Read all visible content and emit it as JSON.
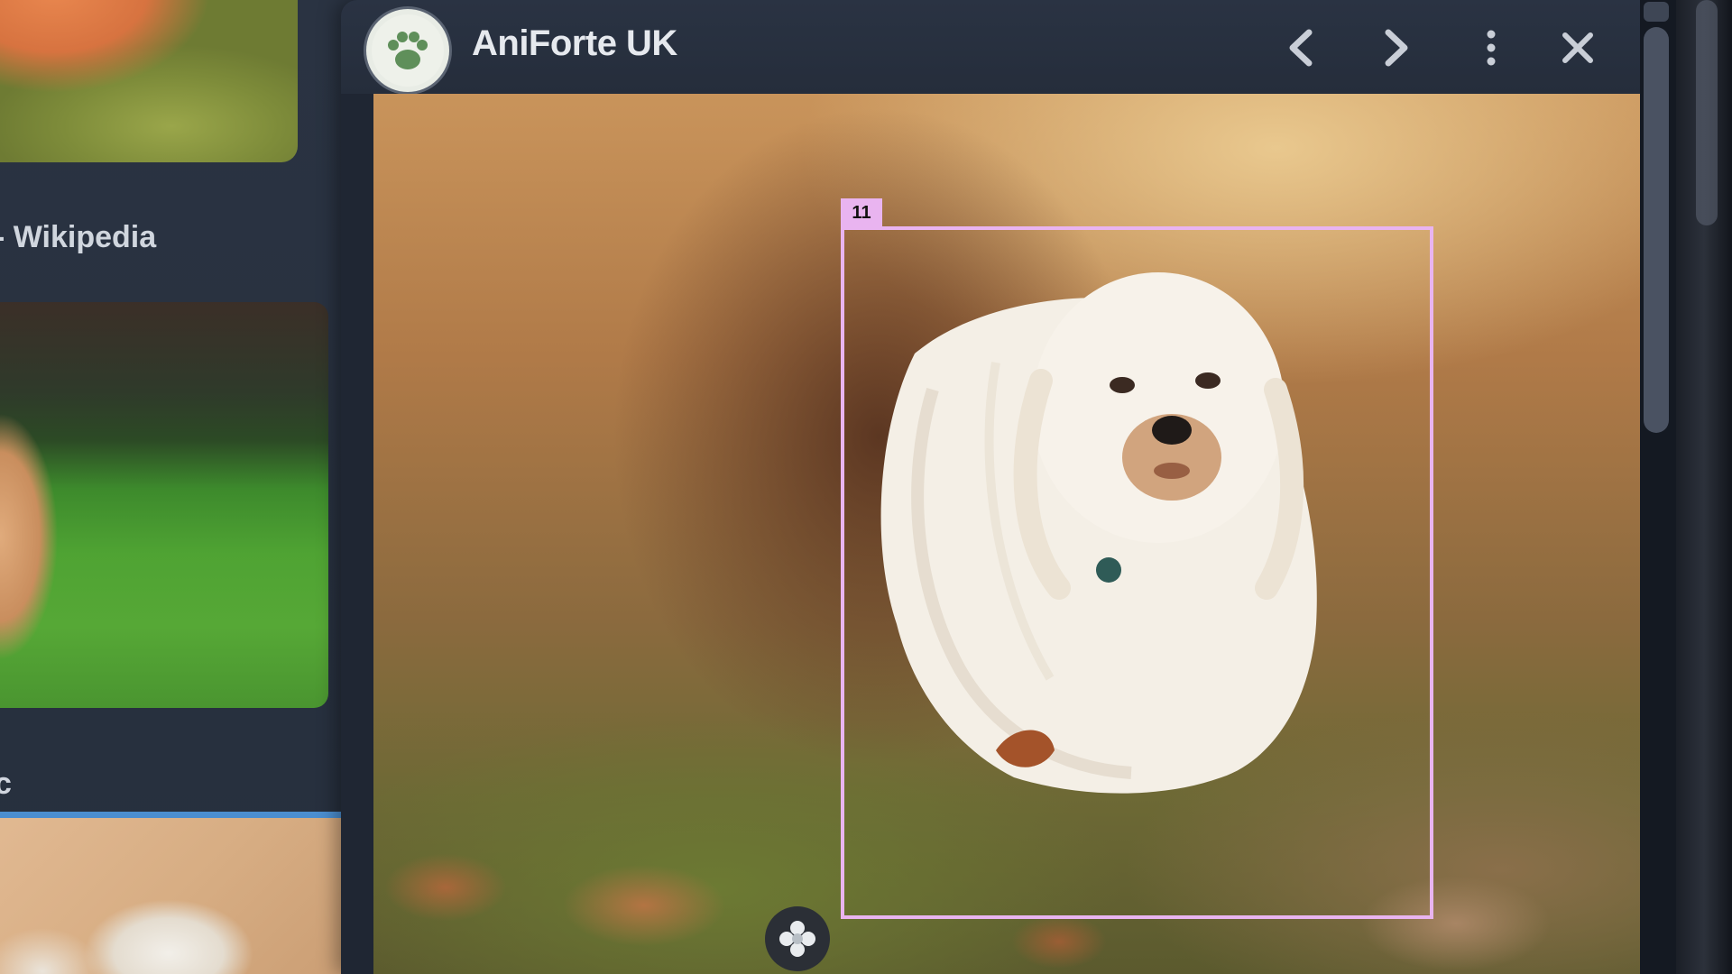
{
  "results": {
    "items": [
      {
        "label": "- Wikipedia",
        "thumb": "orange-long-haired-dog-on-grass"
      },
      {
        "label": "c",
        "thumb": "dog-on-green-lawn"
      },
      {
        "label": "",
        "thumb": "white-fluffy-dog",
        "selected": true
      }
    ]
  },
  "viewer": {
    "site_name": "AniForte UK",
    "logo_icon": "paw-icon",
    "buttons": {
      "prev": "chevron-left-icon",
      "next": "chevron-right-icon",
      "more": "more-vertical-icon",
      "close": "close-icon"
    },
    "image_subject": "white-long-haired-dog-photo",
    "detection_tag": "11",
    "badge_icon": "flower-icon"
  },
  "colors": {
    "detection_box": "#e9b4f0",
    "selection_border": "#4b8ed0",
    "header_bg": "#2a3343",
    "text": "#e6e9ee"
  }
}
